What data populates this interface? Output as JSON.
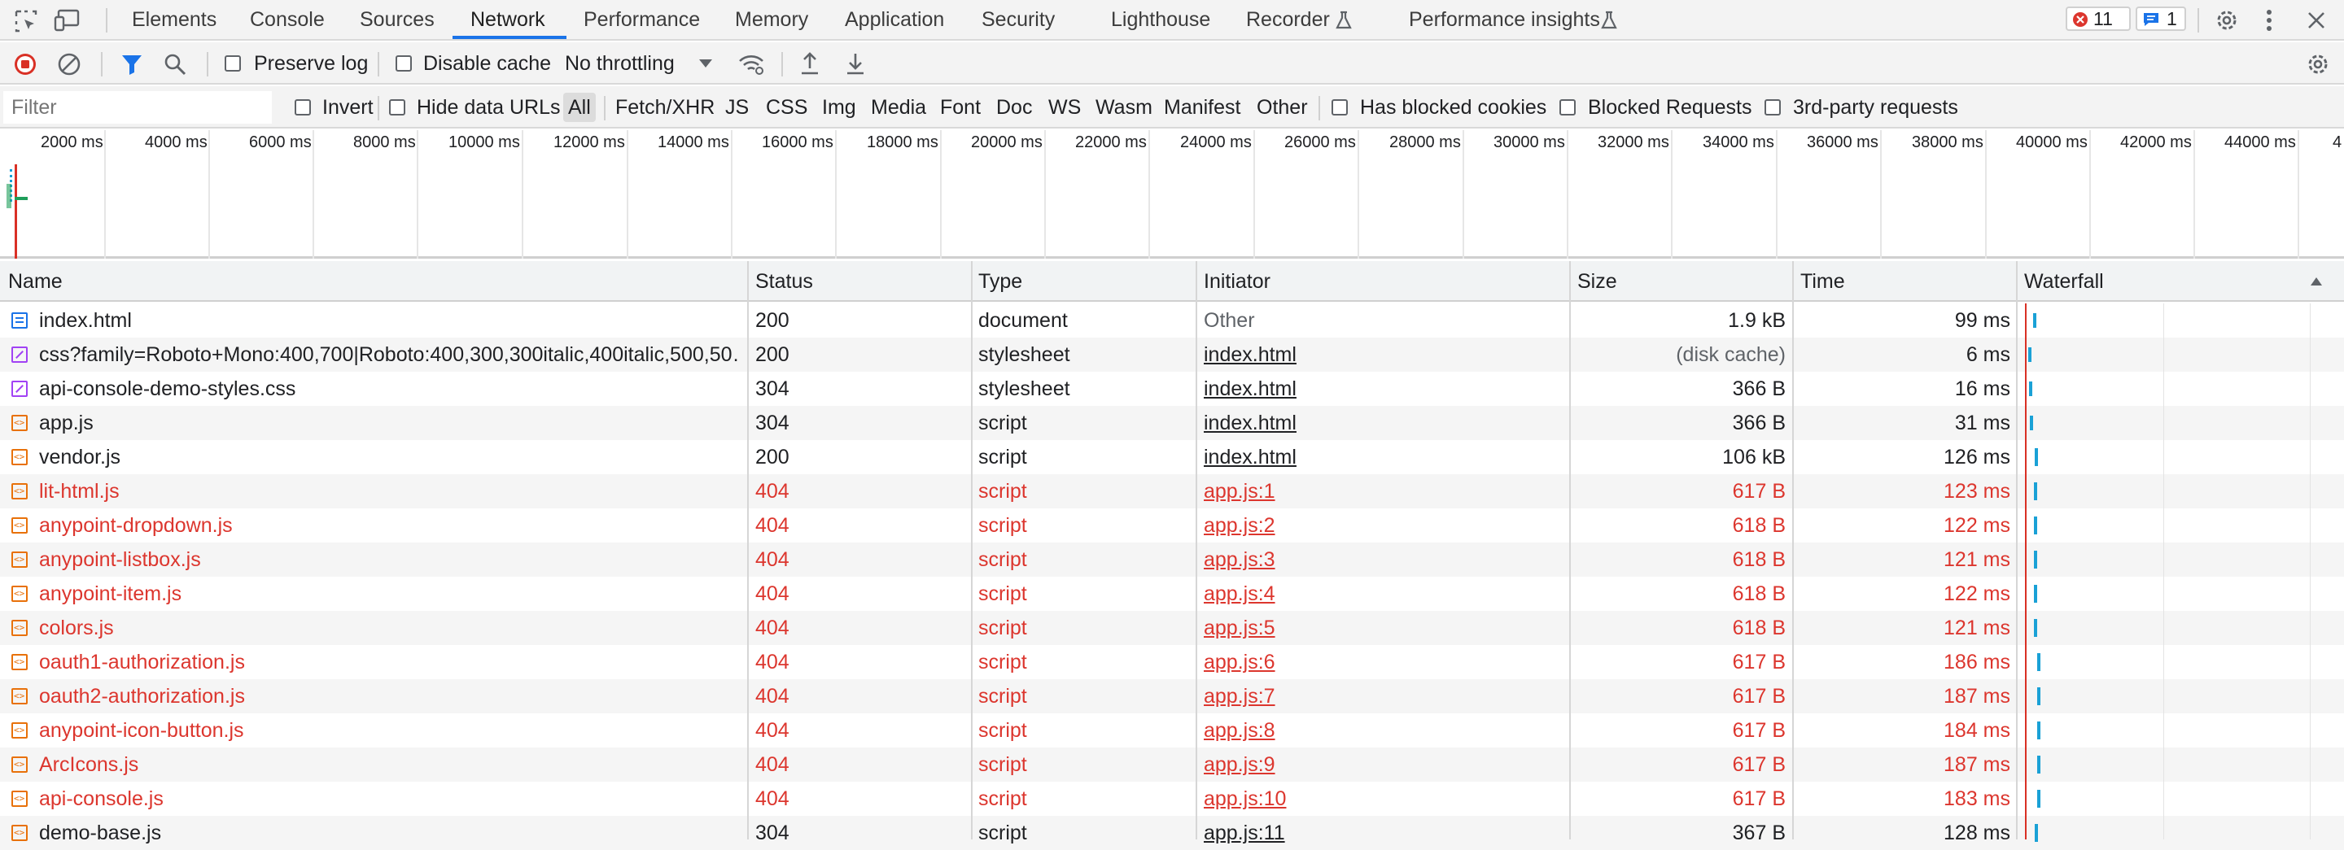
{
  "tabs": [
    "Elements",
    "Console",
    "Sources",
    "Network",
    "Performance",
    "Memory",
    "Application",
    "Security",
    "Lighthouse",
    "Recorder",
    "Performance insights"
  ],
  "badges": {
    "errors": "11",
    "messages": "1"
  },
  "toolbar": {
    "preserve_log": "Preserve log",
    "disable_cache": "Disable cache",
    "throttling": "No throttling"
  },
  "filterbar": {
    "placeholder": "Filter",
    "invert": "Invert",
    "hide_data_urls": "Hide data URLs",
    "types": [
      "All",
      "Fetch/XHR",
      "JS",
      "CSS",
      "Img",
      "Media",
      "Font",
      "Doc",
      "WS",
      "Wasm",
      "Manifest",
      "Other"
    ],
    "has_blocked_cookies": "Has blocked cookies",
    "blocked_requests": "Blocked Requests",
    "third_party": "3rd-party requests"
  },
  "overview": {
    "ticks": [
      "2000 ms",
      "4000 ms",
      "6000 ms",
      "8000 ms",
      "10000 ms",
      "12000 ms",
      "14000 ms",
      "16000 ms",
      "18000 ms",
      "20000 ms",
      "22000 ms",
      "24000 ms",
      "26000 ms",
      "28000 ms",
      "30000 ms",
      "32000 ms",
      "34000 ms",
      "36000 ms",
      "38000 ms",
      "40000 ms",
      "42000 ms",
      "44000 ms",
      "4"
    ]
  },
  "table": {
    "columns": {
      "name": "Name",
      "status": "Status",
      "type": "Type",
      "initiator": "Initiator",
      "size": "Size",
      "time": "Time",
      "waterfall": "Waterfall"
    },
    "rows": [
      {
        "name": "index.html",
        "status": "200",
        "type": "document",
        "initiator": "Other",
        "size": "1.9 kB",
        "time": "99 ms",
        "icon": "document-icon",
        "error": false
      },
      {
        "name": "css?family=Roboto+Mono:400,700|Roboto:400,300,300italic,400italic,500,50…",
        "status": "200",
        "type": "stylesheet",
        "initiator": "index.html",
        "size": "(disk cache)",
        "time": "6 ms",
        "icon": "stylesheet-icon",
        "error": false
      },
      {
        "name": "api-console-demo-styles.css",
        "status": "304",
        "type": "stylesheet",
        "initiator": "index.html",
        "size": "366 B",
        "time": "16 ms",
        "icon": "stylesheet-icon",
        "error": false
      },
      {
        "name": "app.js",
        "status": "304",
        "type": "script",
        "initiator": "index.html",
        "size": "366 B",
        "time": "31 ms",
        "icon": "script-icon",
        "error": false
      },
      {
        "name": "vendor.js",
        "status": "200",
        "type": "script",
        "initiator": "index.html",
        "size": "106 kB",
        "time": "126 ms",
        "icon": "script-icon",
        "error": false
      },
      {
        "name": "lit-html.js",
        "status": "404",
        "type": "script",
        "initiator": "app.js:1",
        "size": "617 B",
        "time": "123 ms",
        "icon": "script-icon",
        "error": true
      },
      {
        "name": "anypoint-dropdown.js",
        "status": "404",
        "type": "script",
        "initiator": "app.js:2",
        "size": "618 B",
        "time": "122 ms",
        "icon": "script-icon",
        "error": true
      },
      {
        "name": "anypoint-listbox.js",
        "status": "404",
        "type": "script",
        "initiator": "app.js:3",
        "size": "618 B",
        "time": "121 ms",
        "icon": "script-icon",
        "error": true
      },
      {
        "name": "anypoint-item.js",
        "status": "404",
        "type": "script",
        "initiator": "app.js:4",
        "size": "618 B",
        "time": "122 ms",
        "icon": "script-icon",
        "error": true
      },
      {
        "name": "colors.js",
        "status": "404",
        "type": "script",
        "initiator": "app.js:5",
        "size": "618 B",
        "time": "121 ms",
        "icon": "script-icon",
        "error": true
      },
      {
        "name": "oauth1-authorization.js",
        "status": "404",
        "type": "script",
        "initiator": "app.js:6",
        "size": "617 B",
        "time": "186 ms",
        "icon": "script-icon",
        "error": true
      },
      {
        "name": "oauth2-authorization.js",
        "status": "404",
        "type": "script",
        "initiator": "app.js:7",
        "size": "617 B",
        "time": "187 ms",
        "icon": "script-icon",
        "error": true
      },
      {
        "name": "anypoint-icon-button.js",
        "status": "404",
        "type": "script",
        "initiator": "app.js:8",
        "size": "617 B",
        "time": "184 ms",
        "icon": "script-icon",
        "error": true
      },
      {
        "name": "ArcIcons.js",
        "status": "404",
        "type": "script",
        "initiator": "app.js:9",
        "size": "617 B",
        "time": "187 ms",
        "icon": "script-icon",
        "error": true
      },
      {
        "name": "api-console.js",
        "status": "404",
        "type": "script",
        "initiator": "app.js:10",
        "size": "617 B",
        "time": "183 ms",
        "icon": "script-icon",
        "error": true
      },
      {
        "name": "demo-base.js",
        "status": "304",
        "type": "script",
        "initiator": "app.js:11",
        "size": "367 B",
        "time": "128 ms",
        "icon": "script-icon",
        "error": false
      }
    ]
  },
  "colors": {
    "accent": "#1a73e8",
    "error": "#dc362e",
    "record": "#d93025",
    "waterfall": "#1aa1d6"
  }
}
